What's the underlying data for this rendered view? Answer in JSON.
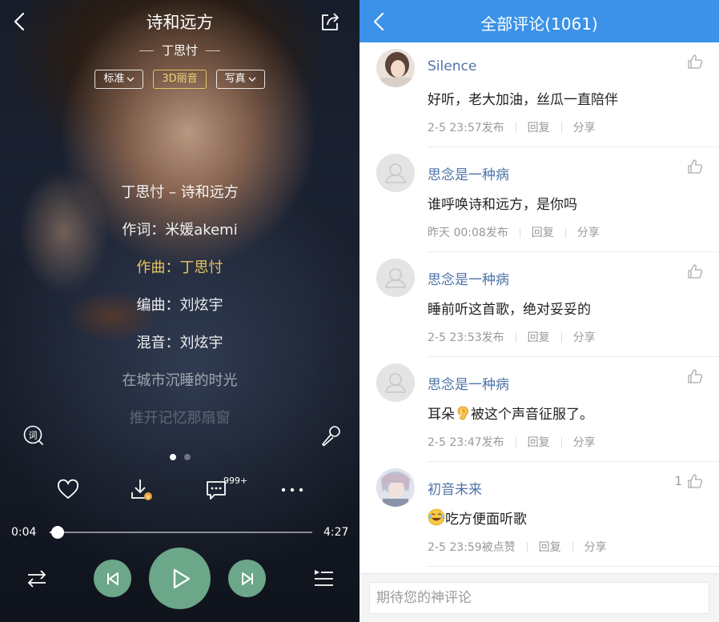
{
  "player": {
    "song_title": "诗和远方",
    "artist": "丁思忖",
    "quality_chips": [
      {
        "label": "标准",
        "dropdown": true,
        "highlight": false
      },
      {
        "label": "3D丽音",
        "dropdown": false,
        "highlight": true
      },
      {
        "label": "写真",
        "dropdown": true,
        "highlight": false
      }
    ],
    "lyrics": [
      {
        "text": "丁思忖 – 诗和远方",
        "state": "normal"
      },
      {
        "text": "作词：米媛akemi",
        "state": "normal"
      },
      {
        "text": "作曲：丁思忖",
        "state": "active"
      },
      {
        "text": "编曲：刘炫宇",
        "state": "normal"
      },
      {
        "text": "混音：刘炫宇",
        "state": "normal"
      },
      {
        "text": "在城市沉睡的时光",
        "state": "dim"
      },
      {
        "text": "推开记忆那扇窗",
        "state": "dimmer"
      }
    ],
    "comment_count_badge": "999+",
    "current_time": "0:04",
    "total_time": "4:27",
    "progress": 0.015,
    "page_dots": [
      true,
      false
    ],
    "accent_color": "#6ba788",
    "lyric_highlight_color": "#e9c363",
    "icons": {
      "back": "back-icon",
      "share": "share-icon",
      "lyric": "lyric-icon",
      "mic": "microphone-icon",
      "like": "heart-icon",
      "download": "download-icon",
      "comment": "comment-icon",
      "more": "more-icon",
      "shuffle": "shuffle-icon",
      "prev": "previous-icon",
      "play": "play-icon",
      "next": "next-icon",
      "playlist": "playlist-icon"
    }
  },
  "comments": {
    "header_title": "全部评论(1061)",
    "header_color": "#3b92e8",
    "items": [
      {
        "name": "Silence",
        "text": "好听，老大加油，丝瓜一直陪伴",
        "time": "2-5 23:57发布",
        "reply": "回复",
        "share": "分享",
        "likes": "",
        "avatar": "photo-girl",
        "emoji": ""
      },
      {
        "name": "思念是一种病",
        "text": "谁呼唤诗和远方，是你吗",
        "time": "昨天 00:08发布",
        "reply": "回复",
        "share": "分享",
        "likes": "",
        "avatar": "default",
        "emoji": ""
      },
      {
        "name": "思念是一种病",
        "text": "睡前听这首歌，绝对妥妥的",
        "time": "2-5 23:53发布",
        "reply": "回复",
        "share": "分享",
        "likes": "",
        "avatar": "default",
        "emoji": ""
      },
      {
        "name": "思念是一种病",
        "text_before": "耳朵",
        "text": "被这个声音征服了。",
        "time": "2-5 23:47发布",
        "reply": "回复",
        "share": "分享",
        "likes": "",
        "avatar": "default",
        "emoji": "ear"
      },
      {
        "name": "初音未来",
        "text": "吃方便面听歌",
        "time": "2-5 23:59被点赞",
        "reply": "回复",
        "share": "分享",
        "likes": "1",
        "avatar": "photo-anime",
        "emoji": "laugh"
      }
    ],
    "input_placeholder": "期待您的神评论"
  }
}
